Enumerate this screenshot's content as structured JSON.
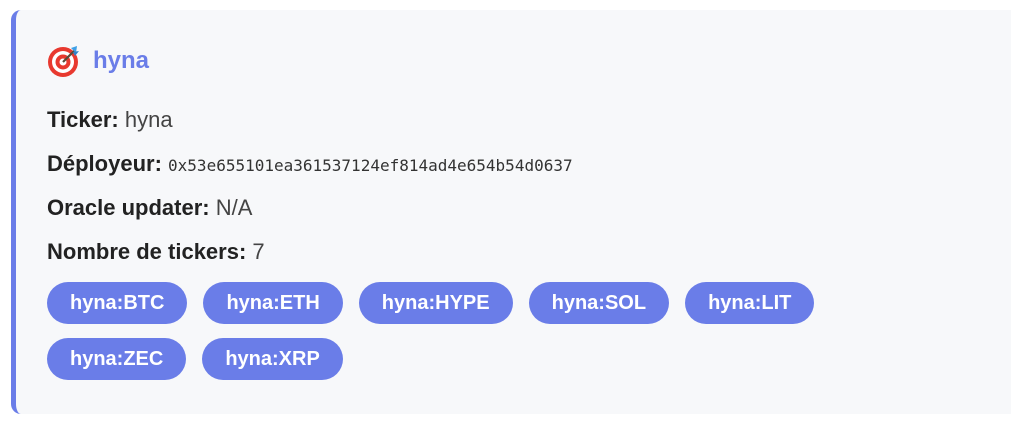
{
  "card": {
    "icon": "target-dart-icon",
    "title": "hyna",
    "rows": [
      {
        "label": "Ticker:",
        "value": "hyna"
      },
      {
        "label": "Déployeur:",
        "value": "0x53e655101ea361537124ef814ad4e654b54d0637"
      },
      {
        "label": "Oracle updater:",
        "value": "N/A"
      },
      {
        "label": "Nombre de tickers:",
        "value": "7"
      }
    ],
    "tags": [
      "hyna:BTC",
      "hyna:ETH",
      "hyna:HYPE",
      "hyna:SOL",
      "hyna:LIT",
      "hyna:ZEC",
      "hyna:XRP"
    ]
  },
  "colors": {
    "accent": "#6a7de8",
    "card_bg": "#f7f8fa"
  }
}
